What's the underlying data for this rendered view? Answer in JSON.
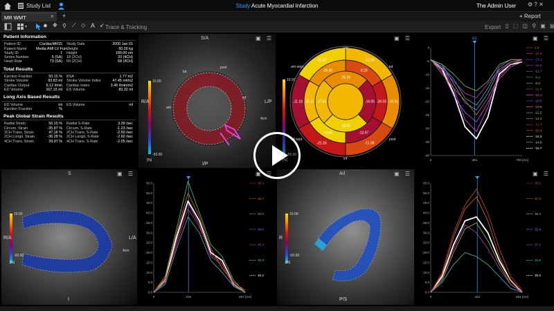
{
  "app": {
    "study_list_label": "Study List",
    "title_prefix": "Study",
    "study_title": "Acute Myocardial Infarction",
    "user_label": "The Admin User",
    "report_label": "+ Report",
    "tab_label": "MR WMT",
    "tab_add": "+",
    "trace_label": "Trace & Tracking",
    "export_label": "Export"
  },
  "patient": {
    "header": "Patient Information",
    "left_rows": [
      {
        "label": "Patient ID",
        "value": "CardiacMR15"
      },
      {
        "label": "Patient Name",
        "value": "Media AMI LV Fun..."
      },
      {
        "label": "Study ID",
        "value": "1"
      },
      {
        "label": "Series Number",
        "value": "5 (SA)"
      },
      {
        "label": "Heart Rate",
        "value": "73 (SA)"
      }
    ],
    "right_rows": [
      {
        "label": "Study Date",
        "value": "2000 Jan 01"
      },
      {
        "label": "Weight",
        "value": "60.00 kg"
      },
      {
        "label": "Height",
        "value": "180.00 cm"
      },
      {
        "label": "18 (2CH)",
        "value": "20 (4CH)"
      },
      {
        "label": "69 (2CH)",
        "value": "68 (4CH)"
      }
    ]
  },
  "total": {
    "header": "Total Results",
    "rows": [
      {
        "l1": "Ejection Fraction",
        "v1": "50.15 %",
        "l2": "BSA",
        "v2": "1.77 m2"
      },
      {
        "l1": "Stroke Volume",
        "v1": "83.83 ml",
        "l2": "Stroke Volume Index",
        "v2": "47.45 ml/m2"
      },
      {
        "l1": "Cardiac Output",
        "v1": "6.12 l/min",
        "l2": "Cardiac Index",
        "v2": "3.46 l/min/m2"
      },
      {
        "l1": "ED Volume",
        "v1": "167.15 ml",
        "l2": "ES Volume",
        "v2": "83.32 ml"
      }
    ]
  },
  "longaxis": {
    "header": "Long Axis Based Results",
    "rows": [
      {
        "l1": "ED Volume",
        "v1": "ml",
        "l2": "ES Volume",
        "v2": "ml"
      },
      {
        "l1": "Ejection Fraction",
        "v1": "%",
        "l2": "",
        "v2": ""
      }
    ]
  },
  "strain": {
    "header": "Peak Global Strain Results",
    "rows": [
      {
        "l1": "Radial Strain",
        "v1": "56.15 %",
        "l2": "Radial S-Rate",
        "v2": "3.39 /sec"
      },
      {
        "l1": "Circum. Strain",
        "v1": "-35.87 %",
        "l2": "Circum. S-Rate",
        "v2": "-1.23 /sec"
      },
      {
        "l1": "2CH Trans. Strain",
        "v1": "47.16 %",
        "l2": "2CH Trans. S-Rate",
        "v2": "-2.50 /sec"
      },
      {
        "l1": "2CH Longit. Strain",
        "v1": "-36.28 %",
        "l2": "2CH Longit. S-Rate",
        "v2": "-2.60 /sec"
      },
      {
        "l1": "4CH Trans. Strain",
        "v1": "39.97 %",
        "l2": "4CH Trans. S-Rate",
        "v2": "-2.05 /sec"
      }
    ]
  },
  "views": {
    "sa": {
      "title": "S/A",
      "left": "R/A",
      "right": "L/P",
      "bottom": "I/P",
      "scale_top": "10.00",
      "scale_bottom": "-50.00",
      "unit": "[%]",
      "lbl_lat": "lat",
      "lbl_post": "post",
      "lbl_ant": "ant",
      "lbl_inf": "inf",
      "scale_unit": "4cm"
    },
    "lax2": {
      "title": "S",
      "left": "R/A",
      "right": "L/A",
      "bottom": "I",
      "scale_top": "10.00",
      "scale_bottom": "-50.00",
      "unit": "[%]",
      "scale_unit": "4cm"
    },
    "lax4": {
      "title": "A/I",
      "left": "R",
      "bottom": "P/S",
      "scale_top": "10.00",
      "scale_bottom": "-50.00",
      "unit": "[%]"
    },
    "bullseye": {
      "scale_top": "10.00",
      "scale_bottom": "-50.00",
      "unit": "[%]",
      "lbl_ant": "ant",
      "lbl_antsept": "ant-sept",
      "lbl_lat": "lat",
      "lbl_infsept": "inf-sept",
      "lbl_post": "post",
      "lbl_inf": "inf",
      "values": [
        "-12.48",
        "-16.92",
        "-11.39",
        "-21.33",
        "-11.18",
        "-15.82",
        "-9.23",
        "-26.03",
        "-13.97",
        "-14.09",
        "-20.31",
        "-26.30",
        "-16.05",
        "-18.00",
        "-17.53",
        "-26.19"
      ]
    }
  },
  "chart_data": [
    {
      "type": "line",
      "title": "",
      "x_ticks": [
        "0",
        "381",
        "793 [ms]"
      ],
      "y_ticks": [
        "0",
        "-5",
        "-10",
        "-15",
        "-20",
        "-25",
        "-30",
        "-35",
        "-40"
      ],
      "marker_label": "ES",
      "marker_x": 381,
      "legend": [
        "2.6",
        "-13.5",
        "-15.1",
        "-16.2",
        "-12.7",
        "-9.6",
        "-9.9",
        "-11.4",
        "-16.1",
        "-18.0",
        "-16.6",
        "-11.2",
        "-12.4",
        "-21.3",
        "-20.4",
        "-24.3",
        "-14.0",
        "-15.7"
      ],
      "legend_colors": [
        "#e07010",
        "#e05010",
        "#9050ff",
        "#c040c0",
        "#60a0ff",
        "#40c0a0",
        "#a0c040",
        "#c07000",
        "#ff40ff",
        "#b060ff",
        "#ff80c0",
        "#80ff80",
        "#c0c040",
        "#d04040",
        "#ff6060",
        "#ffffff",
        "#e0e0e0",
        "#ffffff"
      ],
      "series": [
        {
          "values": [
            0,
            -4,
            -14,
            -28,
            -33,
            -24,
            -6,
            -2,
            -1
          ],
          "color": "#ffffff"
        },
        {
          "values": [
            0,
            -3,
            -12,
            -25,
            -30,
            -20,
            -5,
            -1,
            0
          ],
          "color": "#ff40ff"
        },
        {
          "values": [
            0,
            -5,
            -15,
            -22,
            -26,
            -18,
            -8,
            -3,
            -1
          ],
          "color": "#b060ff"
        },
        {
          "values": [
            0,
            -2,
            -10,
            -18,
            -21,
            -14,
            -4,
            -1,
            0
          ],
          "color": "#60a0ff"
        },
        {
          "values": [
            0,
            -3,
            -8,
            -16,
            -19,
            -12,
            -3,
            0,
            0
          ],
          "color": "#40c0a0"
        },
        {
          "values": [
            0,
            -6,
            -12,
            -17,
            -23,
            -16,
            -7,
            -2,
            0
          ],
          "color": "#e07010"
        },
        {
          "values": [
            0,
            -2,
            -6,
            -11,
            -13,
            -9,
            -2,
            0,
            0
          ],
          "color": "#a0c040"
        },
        {
          "values": [
            0,
            -4,
            -9,
            -14,
            -16,
            -10,
            -4,
            -1,
            0
          ],
          "color": "#c040c0"
        }
      ],
      "ylim": [
        -40,
        5
      ]
    },
    {
      "type": "line",
      "title": "",
      "x_ticks": [
        "0",
        "318",
        "837 [ms]"
      ],
      "y_ticks": [
        "55.0",
        "50.0",
        "45.0",
        "40.0",
        "35.0",
        "30.0",
        "25.0",
        "20.0",
        "15.0",
        "10.0",
        "5.0",
        "0.0"
      ],
      "marker_x": 318,
      "legend": [
        "38.4",
        "38.7",
        "56.0",
        "38.6",
        "45.4",
        "38.3",
        "46.2"
      ],
      "legend_colors": [
        "#d04040",
        "#e07010",
        "#60c060",
        "#6080ff",
        "#c040c0",
        "#40c0c0",
        "#ffffff"
      ],
      "series": [
        {
          "values": [
            0,
            6,
            28,
            46,
            36,
            20,
            16,
            4,
            0
          ],
          "color": "#ffffff"
        },
        {
          "values": [
            0,
            8,
            32,
            56,
            40,
            24,
            18,
            6,
            0
          ],
          "color": "#60c060"
        },
        {
          "values": [
            0,
            5,
            26,
            45,
            34,
            18,
            14,
            3,
            0
          ],
          "color": "#c040c0"
        },
        {
          "values": [
            0,
            7,
            30,
            50,
            38,
            22,
            12,
            5,
            1
          ],
          "color": "#e07010"
        },
        {
          "values": [
            0,
            4,
            22,
            38,
            30,
            16,
            10,
            3,
            0
          ],
          "color": "#40c0c0"
        },
        {
          "values": [
            0,
            6,
            24,
            42,
            33,
            19,
            15,
            4,
            0
          ],
          "color": "#d04040"
        }
      ],
      "ylim": [
        0,
        55
      ]
    },
    {
      "type": "line",
      "title": "",
      "x_ticks": [
        "0",
        "433",
        "851 [ms]"
      ],
      "y_ticks": [
        "55.0",
        "50.0",
        "45.0",
        "40.0",
        "35.0",
        "30.0",
        "25.0",
        "20.0",
        "15.0",
        "10.0",
        "5.0",
        "0.0"
      ],
      "marker_x": 433,
      "legend": [
        "38.9",
        "47.8",
        "38.4",
        "32.4",
        "37.2",
        "15.8",
        "35.5"
      ],
      "legend_colors": [
        "#d04040",
        "#e07010",
        "#a0c040",
        "#60a0ff",
        "#c040c0",
        "#40c0c0",
        "#ffffff"
      ],
      "series": [
        {
          "values": [
            0,
            8,
            24,
            36,
            38,
            30,
            16,
            6,
            0
          ],
          "color": "#ffffff"
        },
        {
          "values": [
            0,
            10,
            30,
            44,
            52,
            40,
            22,
            8,
            1
          ],
          "color": "#d04040"
        },
        {
          "values": [
            0,
            9,
            28,
            42,
            48,
            36,
            18,
            6,
            0
          ],
          "color": "#e07010"
        },
        {
          "values": [
            0,
            6,
            20,
            32,
            35,
            26,
            14,
            4,
            0
          ],
          "color": "#a0c040"
        },
        {
          "values": [
            0,
            5,
            14,
            20,
            18,
            14,
            8,
            2,
            0
          ],
          "color": "#40c0c0"
        },
        {
          "values": [
            0,
            7,
            22,
            34,
            30,
            22,
            12,
            4,
            0
          ],
          "color": "#c040c0"
        }
      ],
      "ylim": [
        0,
        55
      ]
    }
  ]
}
